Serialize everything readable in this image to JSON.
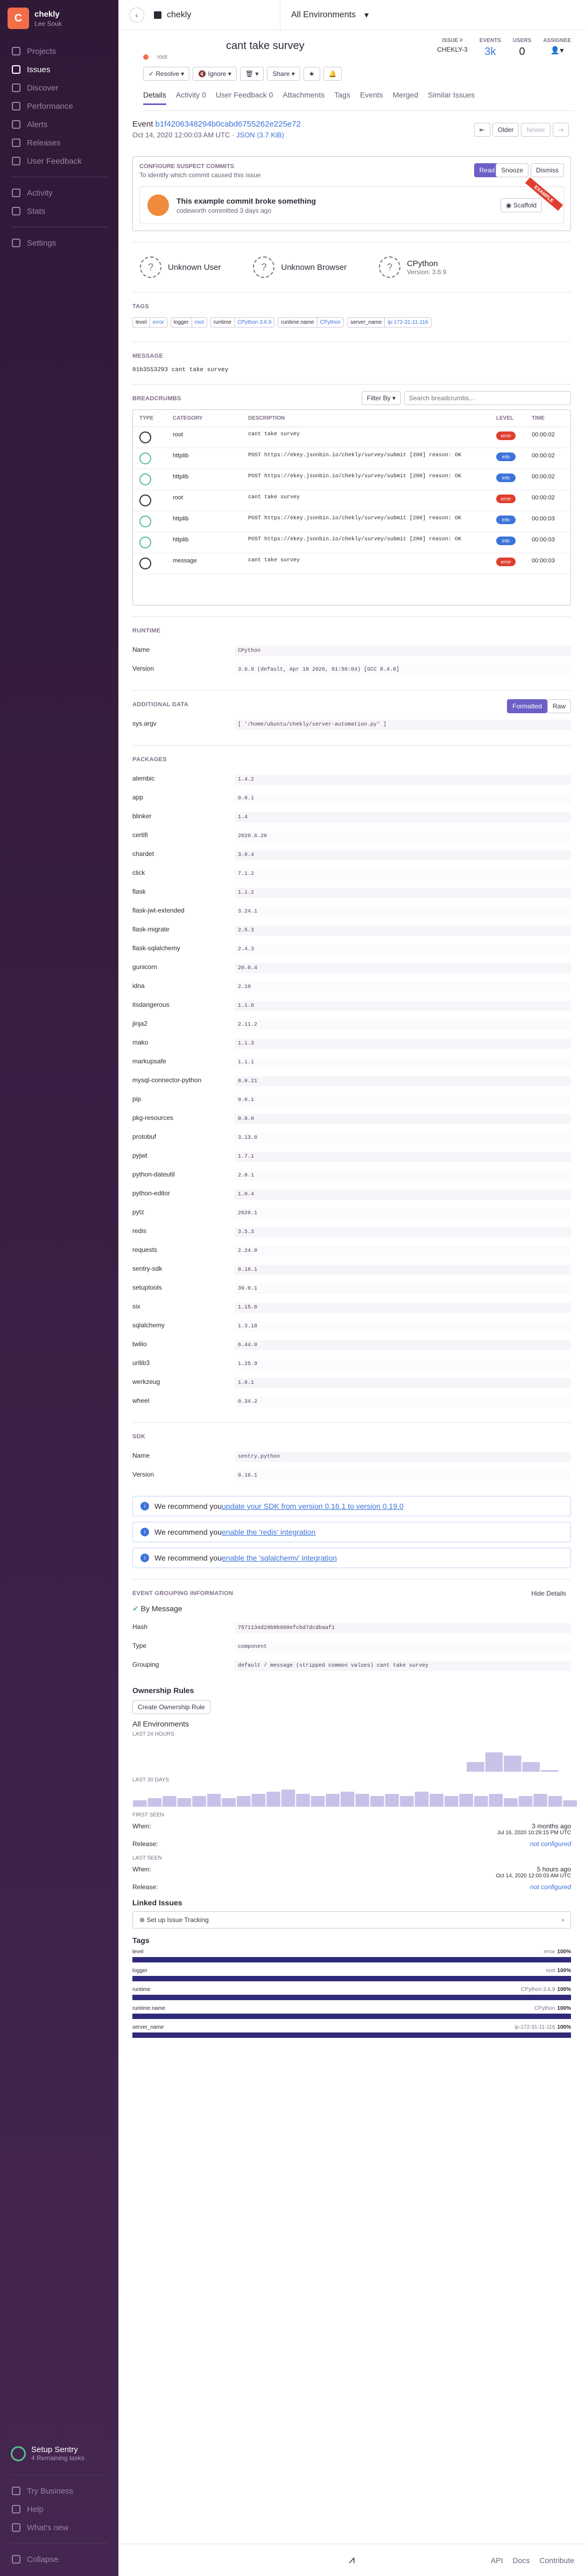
{
  "org": {
    "initial": "C",
    "name": "chekly",
    "user": "Lee Souk"
  },
  "nav": [
    {
      "label": "Projects",
      "active": false
    },
    {
      "label": "Issues",
      "active": true
    },
    {
      "label": "Discover",
      "active": false
    },
    {
      "label": "Performance",
      "active": false
    },
    {
      "label": "Alerts",
      "active": false
    },
    {
      "label": "Releases",
      "active": false
    },
    {
      "label": "User Feedback",
      "active": false
    },
    {
      "label": "Activity",
      "active": false
    },
    {
      "label": "Stats",
      "active": false
    },
    {
      "label": "Settings",
      "active": false
    }
  ],
  "sidebar_bottom": {
    "setup_title": "Setup Sentry",
    "setup_sub": "4 Remaining tasks",
    "try_business": "Try Business",
    "help": "Help",
    "whats_new": "What's new",
    "collapse": "Collapse"
  },
  "topbar": {
    "project": "chekly",
    "environment": "All Environments"
  },
  "issue": {
    "title": "cant take survey",
    "crumb": "root",
    "issue_label": "ISSUE #",
    "issue_id": "CHEKLY-3",
    "events_label": "EVENTS",
    "events": "3k",
    "users_label": "USERS",
    "users": "0",
    "assignee_label": "ASSIGNEE"
  },
  "actions": {
    "resolve": "Resolve",
    "ignore": "Ignore",
    "share": "Share"
  },
  "tabs": [
    {
      "label": "Details",
      "on": true
    },
    {
      "label": "Activity 0",
      "on": false
    },
    {
      "label": "User Feedback 0",
      "on": false
    },
    {
      "label": "Attachments",
      "on": false
    },
    {
      "label": "Tags",
      "on": false
    },
    {
      "label": "Events",
      "on": false
    },
    {
      "label": "Merged",
      "on": false
    },
    {
      "label": "Similar Issues",
      "on": false
    }
  ],
  "event": {
    "prefix": "Event",
    "id": "b1f4206348294b0cabd6755262e225e72",
    "date": "Oct 14, 2020 12:00:03 AM UTC",
    "size": "JSON (3.7 KiB)",
    "older": "Older",
    "newer": "Newer"
  },
  "suspect": {
    "heading": "CONFIGURE SUSPECT COMMITS",
    "sub": "To identify which commit caused this issue",
    "read_docs": "Read the docs",
    "snooze": "Snooze",
    "dismiss": "Dismiss",
    "commit_title": "This example commit broke something",
    "commit_sub": "codeworth committed 3 days ago",
    "example": "EXAMPLE",
    "scaffold": "Scaffold"
  },
  "context": [
    {
      "icon": "?",
      "title": "Unknown User",
      "sub": ""
    },
    {
      "icon": "?",
      "title": "Unknown Browser",
      "sub": ""
    },
    {
      "icon": "?",
      "title": "CPython",
      "sub": "Version: 3.6.9"
    }
  ],
  "tags_heading": "TAGS",
  "tags": [
    {
      "k": "level",
      "v": "error"
    },
    {
      "k": "logger",
      "v": "root"
    },
    {
      "k": "runtime",
      "v": "CPython 3.6.9"
    },
    {
      "k": "runtime.name",
      "v": "CPython"
    },
    {
      "k": "server_name",
      "v": "ip-172-31-11-116"
    }
  ],
  "message": {
    "heading": "MESSAGE",
    "text": "01b3553293 cant take survey"
  },
  "breadcrumbs": {
    "heading": "BREADCRUMBS",
    "filter": "Filter By",
    "search_placeholder": "Search breadcrumbs...",
    "cols": [
      "TYPE",
      "CATEGORY",
      "DESCRIPTION",
      "LEVEL",
      "TIME"
    ],
    "rows": [
      {
        "cat": "root",
        "desc": "cant take survey",
        "link": "",
        "level": "error",
        "time": "00:00:02"
      },
      {
        "cat": "httplib",
        "desc": "POST https://ekey.jsonbin.io/chekly/survey/submit [200] reason: OK",
        "link": "",
        "level": "info",
        "time": "00:00:02"
      },
      {
        "cat": "httplib",
        "desc": "POST https://ekey.jsonbin.io/chekly/survey/submit [200] reason: OK",
        "link": "",
        "level": "info",
        "time": "00:00:02"
      },
      {
        "cat": "root",
        "desc": "cant take survey",
        "link": "",
        "level": "error",
        "time": "00:00:02"
      },
      {
        "cat": "httplib",
        "desc": "POST https://ekey.jsonbin.io/chekly/survey/submit [200] reason: OK",
        "link": "",
        "level": "info",
        "time": "00:00:03"
      },
      {
        "cat": "httplib",
        "desc": "POST https://ekey.jsonbin.io/chekly/survey/submit [200] reason: OK",
        "link": "",
        "level": "info",
        "time": "00:00:03"
      },
      {
        "cat": "message",
        "desc": "cant take survey",
        "link": "",
        "level": "error",
        "time": "00:00:03"
      }
    ]
  },
  "runtime": {
    "heading": "RUNTIME",
    "rows": [
      {
        "k": "Name",
        "v": "CPython"
      },
      {
        "k": "Version",
        "v": "3.6.9 (default, Apr 18 2020, 01:56:04) [GCC 8.4.0]"
      }
    ]
  },
  "additional": {
    "heading": "ADDITIONAL DATA",
    "formatted": "Formatted",
    "raw": "Raw",
    "rows": [
      {
        "k": "sys.argv",
        "v": "[ '/home/ubuntu/chekly/server-automation.py' ]"
      }
    ]
  },
  "packages": {
    "heading": "PACKAGES",
    "rows": [
      {
        "k": "alembic",
        "v": "1.4.2"
      },
      {
        "k": "app",
        "v": "0.0.1"
      },
      {
        "k": "blinker",
        "v": "1.4"
      },
      {
        "k": "certifi",
        "v": "2020.6.20"
      },
      {
        "k": "chardet",
        "v": "3.0.4"
      },
      {
        "k": "click",
        "v": "7.1.2"
      },
      {
        "k": "flask",
        "v": "1.1.2"
      },
      {
        "k": "flask-jwt-extended",
        "v": "3.24.1"
      },
      {
        "k": "flask-migrate",
        "v": "2.5.3"
      },
      {
        "k": "flask-sqlalchemy",
        "v": "2.4.3"
      },
      {
        "k": "gunicorn",
        "v": "20.0.4"
      },
      {
        "k": "idna",
        "v": "2.10"
      },
      {
        "k": "itsdangerous",
        "v": "1.1.0"
      },
      {
        "k": "jinja2",
        "v": "2.11.2"
      },
      {
        "k": "mako",
        "v": "1.1.3"
      },
      {
        "k": "markupsafe",
        "v": "1.1.1"
      },
      {
        "k": "mysql-connector-python",
        "v": "8.0.21"
      },
      {
        "k": "pip",
        "v": "9.0.1"
      },
      {
        "k": "pkg-resources",
        "v": "0.0.0"
      },
      {
        "k": "protobuf",
        "v": "3.13.0"
      },
      {
        "k": "pyjwt",
        "v": "1.7.1"
      },
      {
        "k": "python-dateutil",
        "v": "2.8.1"
      },
      {
        "k": "python-editor",
        "v": "1.0.4"
      },
      {
        "k": "pytz",
        "v": "2020.1"
      },
      {
        "k": "redis",
        "v": "3.5.3"
      },
      {
        "k": "requests",
        "v": "2.24.0"
      },
      {
        "k": "sentry-sdk",
        "v": "0.16.1"
      },
      {
        "k": "setuptools",
        "v": "39.0.1"
      },
      {
        "k": "six",
        "v": "1.15.0"
      },
      {
        "k": "sqlalchemy",
        "v": "1.3.18"
      },
      {
        "k": "twilio",
        "v": "6.44.0"
      },
      {
        "k": "urllib3",
        "v": "1.25.9"
      },
      {
        "k": "werkzeug",
        "v": "1.0.1"
      },
      {
        "k": "wheel",
        "v": "0.34.2"
      }
    ]
  },
  "sdk": {
    "heading": "SDK",
    "rows": [
      {
        "k": "Name",
        "v": "sentry.python"
      },
      {
        "k": "Version",
        "v": "0.16.1"
      }
    ]
  },
  "recs": [
    {
      "pre": "We recommend you ",
      "link": "update your SDK from version 0.16.1 to version 0.19.0"
    },
    {
      "pre": "We recommend you ",
      "link": "enable the 'redis' integration"
    },
    {
      "pre": "We recommend you ",
      "link": "enable the 'sqlalchemy' integration"
    }
  ],
  "grouping": {
    "heading": "EVENT GROUPING INFORMATION",
    "hide": "Hide Details",
    "by": "By Message",
    "rows": [
      {
        "k": "Hash",
        "v": "7571134d29b8b968efcbd7dcdbaaf1"
      },
      {
        "k": "Type",
        "v": "component"
      },
      {
        "k": "Grouping",
        "v": "default / message (stripped common values) cant take survey"
      }
    ]
  },
  "ownership": {
    "title": "Ownership Rules",
    "button": "Create Ownership Rule"
  },
  "side": {
    "env": "All Environments",
    "last24": "LAST 24 HOURS",
    "last30": "LAST 30 DAYS",
    "first_seen": "FIRST SEEN",
    "first_when": "3 months ago",
    "first_date": "Jul 16, 2020 10:29:15 PM UTC",
    "last_seen": "LAST SEEN",
    "last_when": "5 hours ago",
    "last_date": "Oct 14, 2020 12:00:03 AM UTC",
    "when": "When:",
    "release": "Release:",
    "not_configured": "not configured",
    "linked": "Linked Issues",
    "tracking": "Set up Issue Tracking",
    "tags_title": "Tags",
    "tag_bars": [
      {
        "k": "level",
        "v": "error",
        "pct": "100%"
      },
      {
        "k": "logger",
        "v": "root",
        "pct": "100%"
      },
      {
        "k": "runtime",
        "v": "CPython 3.6.9",
        "pct": "100%"
      },
      {
        "k": "runtime.name",
        "v": "CPython",
        "pct": "100%"
      },
      {
        "k": "server_name",
        "v": "ip-172-31-11-116",
        "pct": "100%"
      }
    ]
  },
  "footer": {
    "api": "API",
    "docs": "Docs",
    "contribute": "Contribute"
  }
}
